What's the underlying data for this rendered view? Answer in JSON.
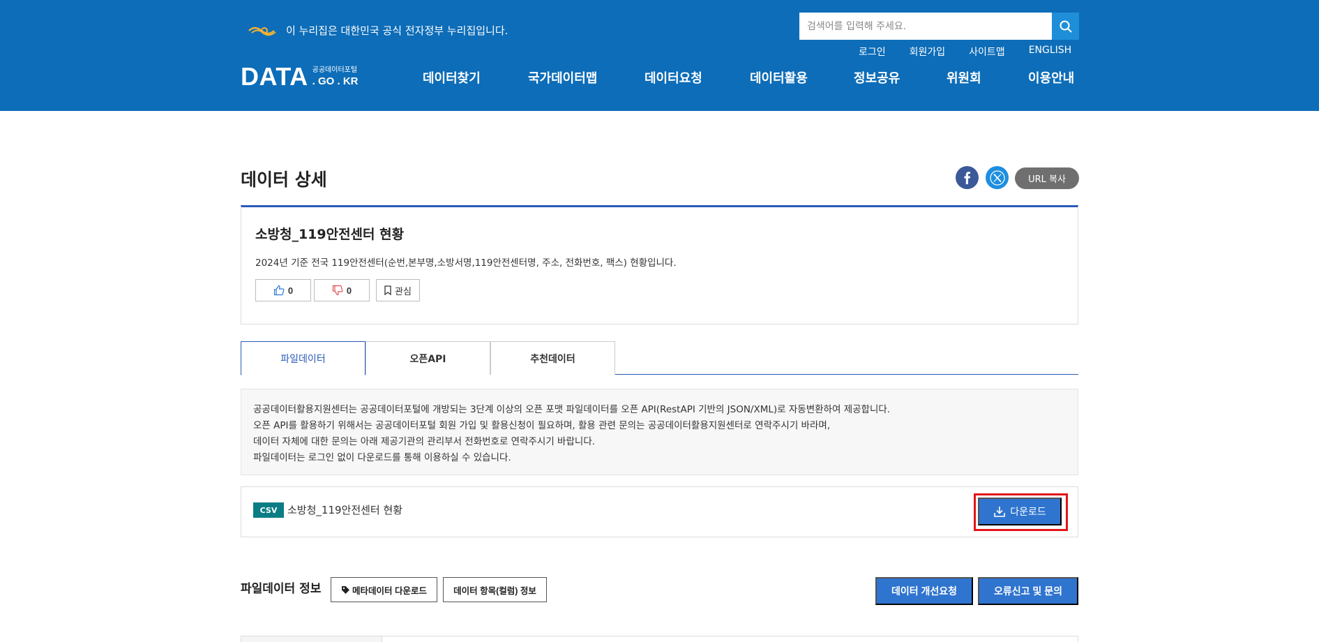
{
  "header": {
    "gov_notice": "이 누리집은 대한민국 공식 전자정부 누리집입니다.",
    "search_placeholder": "검색어를 입력해 주세요.",
    "util_links": [
      "로그인",
      "회원가입",
      "사이트맵",
      "ENGLISH"
    ],
    "logo_main": "DATA",
    "logo_sub1": "공공데이터포털",
    "logo_sub2": ". GO . KR",
    "nav": [
      "데이터찾기",
      "국가데이터맵",
      "데이터요청",
      "데이터활용",
      "정보공유",
      "위원회",
      "이용안내"
    ],
    "colors": {
      "background": "#0d6db8",
      "search_button": "#1f8ed8"
    }
  },
  "page": {
    "title": "데이터 상세",
    "share": {
      "facebook_icon": "facebook-icon",
      "x_icon": "x-icon",
      "url_copy": "URL 복사"
    }
  },
  "dataset": {
    "title": "소방청_119안전센터 현황",
    "description": "2024년 기준 전국 119안전센터(순번,본부명,소방서명,119안전센터명, 주소, 전화번호, 팩스) 현황입니다.",
    "likes": "0",
    "dislikes": "0",
    "bookmark_label": "관심"
  },
  "tabs": [
    {
      "label": "파일데이터",
      "active": true
    },
    {
      "label": "오픈API",
      "active": false
    },
    {
      "label": "추천데이터",
      "active": false
    }
  ],
  "notice_lines": [
    "공공데이터활용지원센터는 공공데이터포털에 개방되는 3단계 이상의 오픈 포맷 파일데이터를 오픈 API(RestAPI 기반의 JSON/XML)로 자동변환하여 제공합니다.",
    "오픈 API를 활용하기 위해서는 공공데이터포털 회원 가입 및 활용신청이 필요하며, 활용 관련 문의는 공공데이터활용지원센터로 연락주시기 바라며,",
    "데이터 자체에 대한 문의는 아래 제공기관의 관리부서 전화번호로 연락주시기 바랍니다.",
    "파일데이터는 로그인 없이 다운로드를 통해 이용하실 수 있습니다."
  ],
  "file": {
    "format": "CSV",
    "name": "소방청_119안전센터 현황",
    "download_label": "다운로드"
  },
  "file_info": {
    "title": "파일데이터 정보",
    "metadata_download": "메타데이터 다운로드",
    "column_info": "데이터 항목(컬럼) 정보",
    "improve_request": "데이터 개선요청",
    "error_report": "오류신고 및 문의"
  }
}
